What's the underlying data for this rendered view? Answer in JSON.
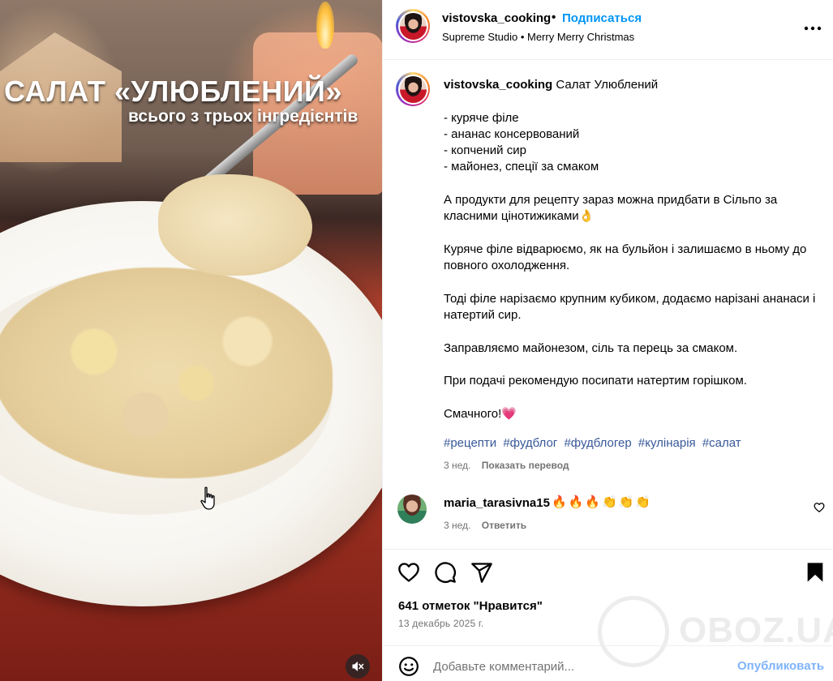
{
  "media": {
    "overlay_title": "САЛАТ «УЛЮБЛЕНИЙ»",
    "overlay_subtitle": "всього з трьох інгредієнтів"
  },
  "header": {
    "username": "vistovska_cooking",
    "separator": "•",
    "follow_label": "Подписаться",
    "audio": "Supreme Studio • Merry Merry Christmas"
  },
  "caption": {
    "username": "vistovska_cooking",
    "text": " Салат Улюблений\n\n- куряче філе\n- ананас консервований\n- копчений сир\n- майонез, спеції за смаком\n\nА продукти для рецепту зараз можна придбати в Сільпо за класними цінотижиками👌\n\nКуряче філе відварюємо, як на бульйон і залишаємо в ньому до повного охолодження.\n\nТоді філе нарізаємо крупним кубиком, додаємо нарізані ананаси і натертий сир.\n\nЗаправляємо майонезом, сіль та перець за смаком.\n\nПри подачі рекомендую посипати натертим горішком.\n\nСмачного!💗",
    "hashtags": [
      "#рецепти",
      "#фудблог",
      "#фудблогер",
      "#кулінарія",
      "#салат"
    ],
    "time": "3 нед.",
    "translate_label": "Показать перевод"
  },
  "comment": {
    "username": "maria_tarasivna15",
    "text": "🔥🔥🔥👏👏👏",
    "time": "3 нед.",
    "reply_label": "Ответить"
  },
  "actions": {
    "likes": "641 отметок \"Нравится\"",
    "date": "13 декабрь 2025 г."
  },
  "watermark": {
    "text": "OBOZ.UA"
  },
  "composer": {
    "placeholder": "Добавьте комментарий...",
    "publish_label": "Опубликовать"
  },
  "colors": {
    "link_blue": "#0095f6",
    "hashtag_blue": "#385898",
    "secondary_text": "#737373",
    "publish_disabled": "#7fb4fb"
  }
}
